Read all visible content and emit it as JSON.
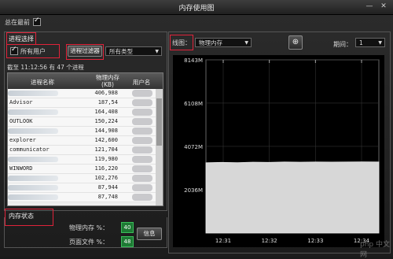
{
  "window": {
    "title": "内存使用图",
    "minimize": "—",
    "close": "✕"
  },
  "topbar": {
    "always_on_top_label": "总在最前",
    "always_on_top_checked": true
  },
  "left": {
    "process_select_label": "进程选择",
    "all_users_label": "所有用户",
    "all_users_checked": true,
    "filter_button_label": "进程过滤器",
    "type_select_value": "所有类型",
    "summary": "截至 11:12:56 有 47 个进程",
    "table": {
      "headers": {
        "name": "进程名称",
        "mem": "物理内存\n(KB)",
        "user": "用户名"
      },
      "rows": [
        {
          "name": "",
          "mem": "406,988"
        },
        {
          "name": "Advisor",
          "mem": "187,54"
        },
        {
          "name": "",
          "mem": "164,408"
        },
        {
          "name": "OUTLOOK",
          "mem": "150,224"
        },
        {
          "name": "",
          "mem": "144,908"
        },
        {
          "name": "explorer",
          "mem": "142,600"
        },
        {
          "name": "communicator",
          "mem": "121,704"
        },
        {
          "name": "",
          "mem": "119,980"
        },
        {
          "name": "WINWORD",
          "mem": "116,220"
        },
        {
          "name": "",
          "mem": "102,276"
        },
        {
          "name": "",
          "mem": "87,944"
        },
        {
          "name": "",
          "mem": "87,748"
        }
      ]
    },
    "memory_status_label": "内存状态",
    "phys_mem_label": "物理内存 %：",
    "phys_mem_value": "40",
    "page_file_label": "页面文件 %：",
    "page_file_value": "48",
    "info_button_label": "信息"
  },
  "right": {
    "line_label": "线图：",
    "line_select_value": "物理内存",
    "period_label": "期间：",
    "period_value": "1",
    "chart_data": {
      "type": "area",
      "y_ticks": [
        "8143M",
        "6108M",
        "4072M",
        "2036M"
      ],
      "x_ticks": [
        "12:31",
        "12:32",
        "12:33",
        "12:34"
      ],
      "values_mb": [
        3300,
        3320,
        3310,
        3330,
        3320,
        3340,
        3330,
        3340,
        3335,
        3340,
        3345,
        3340
      ],
      "ylim": [
        0,
        8143
      ],
      "fill_color": "#d7d7d7",
      "grid": true
    }
  },
  "watermark": "php 中文网"
}
